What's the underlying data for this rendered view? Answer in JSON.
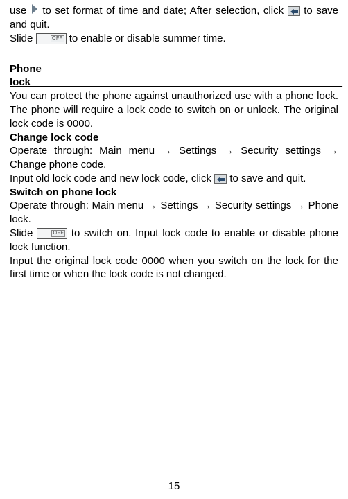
{
  "p1_a": "use ",
  "p1_b": " to set format of time and date; After selection, click ",
  "p1_c": " to save and quit.",
  "p2_a": "Slide ",
  "p2_b": " to enable or disable summer time.",
  "heading1": "Phone lock",
  "p3": "You can protect the phone against unauthorized use with a phone lock. The phone will require a lock code to switch on or unlock. The original lock code is 0000.",
  "sub1": "Change lock code",
  "p4": "Operate through: Main menu → Settings → Security settings → Change phone code.",
  "p5_a": "Input old lock code and new lock code, click ",
  "p5_b": " to save and quit.",
  "sub2": "Switch on phone lock",
  "p6": "Operate through: Main menu → Settings → Security settings → Phone lock.",
  "p7_a": "Slide ",
  "p7_b": " to switch on. Input lock code to enable or disable phone lock function.",
  "p8": "Input the original lock code 0000 when you switch on the lock for the first time or when the lock code is not changed.",
  "toggle_label": "OFF",
  "pagenum": "15",
  "icons": {
    "chevron": "chevron-right-icon",
    "back": "back-icon",
    "toggle": "toggle-off-icon"
  }
}
